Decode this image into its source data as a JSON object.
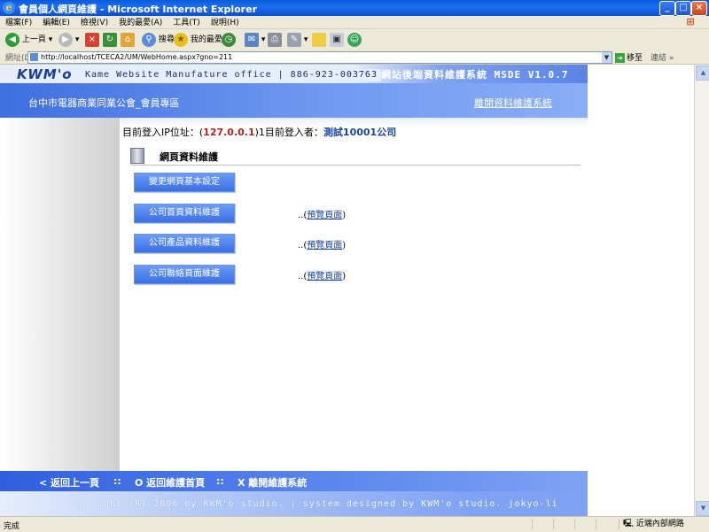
{
  "window": {
    "title": "會員個人網頁維護 - Microsoft Internet Explorer"
  },
  "menu": [
    "檔案(F)",
    "編輯(E)",
    "檢視(V)",
    "我的最愛(A)",
    "工具(T)",
    "說明(H)"
  ],
  "toolbar": {
    "back": "上一頁",
    "search": "搜尋",
    "favorites": "我的最愛"
  },
  "address": {
    "label": "網址(D)",
    "url": "http://localhost/TCECA2/UM/WebHome.aspx?gno=211",
    "go": "移至",
    "links": "連結"
  },
  "header": {
    "logo": "KWM'o",
    "company": "Kame Website Manufature office | 886-923-003763",
    "system_name": "網站後端資料維護系統 MSDE V1.0.7",
    "association": "台中市電器商業同業公會_會員專區",
    "leave_link": "離開資料維護系統"
  },
  "login": {
    "ip_prefix": "目前登入IP位址：(",
    "ip": "127.0.0.1",
    "user_prefix": ")1目前登入者：",
    "user": "測試10001公司"
  },
  "section": {
    "title": "網頁資料維護"
  },
  "buttons": {
    "basic_settings": "變更網頁基本設定",
    "home_data": "公司首頁資料維護",
    "product_data": "公司產品資料維護",
    "contact_page": "公司聯絡頁面維護"
  },
  "preview": {
    "prefix": "..(",
    "link": "預覽頁面",
    "suffix": ")"
  },
  "footer": {
    "back": "< 返回上一頁",
    "sep1": "::",
    "home": "O 返回維護首頁",
    "sep2": "::",
    "exit": "X 離開維護系統",
    "copyright": "copyright (R) 2006 by  KWM'o studio.   |   system designed by KWM'o studio. jokyo-li"
  },
  "status": {
    "text": "完成",
    "zone": "近端內部網路"
  }
}
